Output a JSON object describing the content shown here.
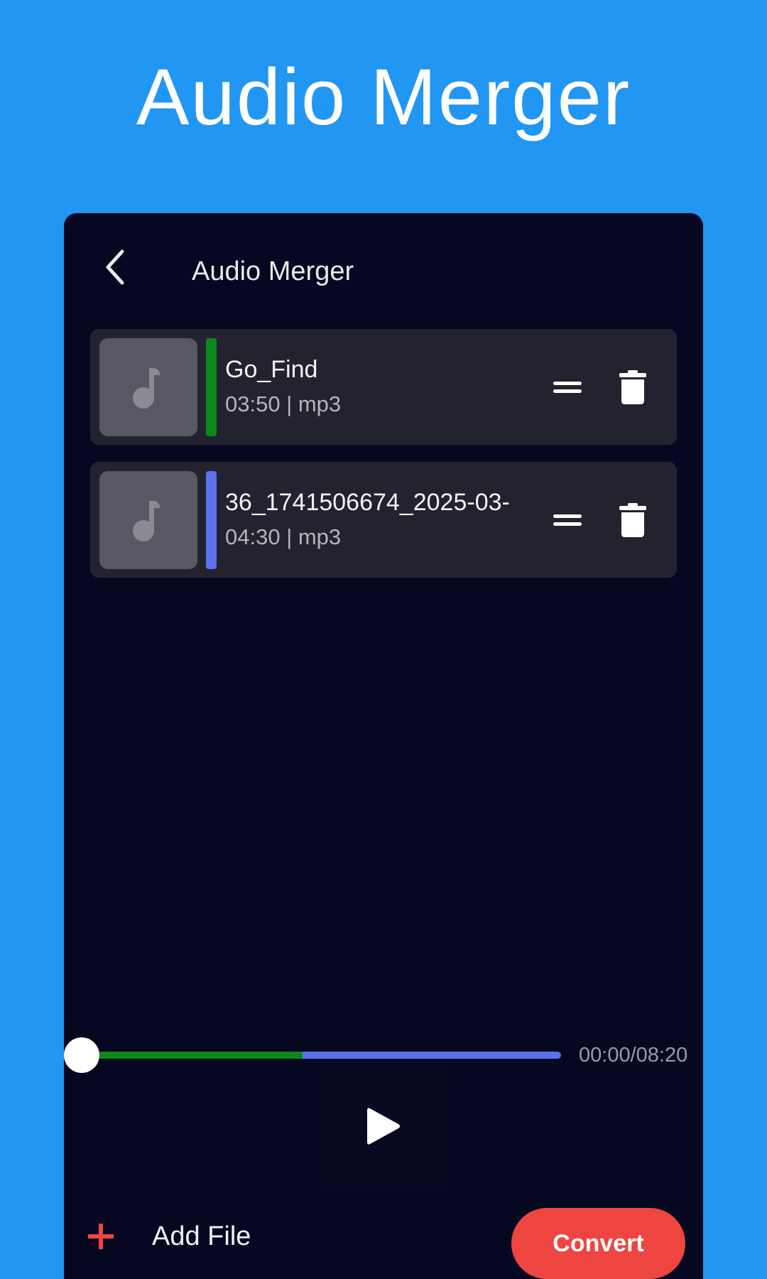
{
  "banner": {
    "title": "Audio Merger"
  },
  "topbar": {
    "title": "Audio Merger",
    "back_icon": "chevron-left-icon"
  },
  "tracks": [
    {
      "name": "Go_Find",
      "meta": "03:50 | mp3",
      "color": "#0a8a1b"
    },
    {
      "name": "36_1741506674_2025-03-",
      "meta": "04:30 | mp3",
      "color": "#5a72f0"
    }
  ],
  "player": {
    "time": "00:00/08:20",
    "position_fraction": 0,
    "segments": [
      {
        "fraction": 0.46,
        "color": "#0a8a1b"
      },
      {
        "fraction": 0.54,
        "color": "#5a72f0"
      }
    ],
    "play_icon": "play-icon"
  },
  "footer": {
    "add_label": "Add File",
    "add_icon": "plus-icon",
    "convert_label": "Convert"
  },
  "colors": {
    "background": "#2196f3",
    "panel": "#060821",
    "card": "#23232f",
    "accent": "#ef4540"
  }
}
